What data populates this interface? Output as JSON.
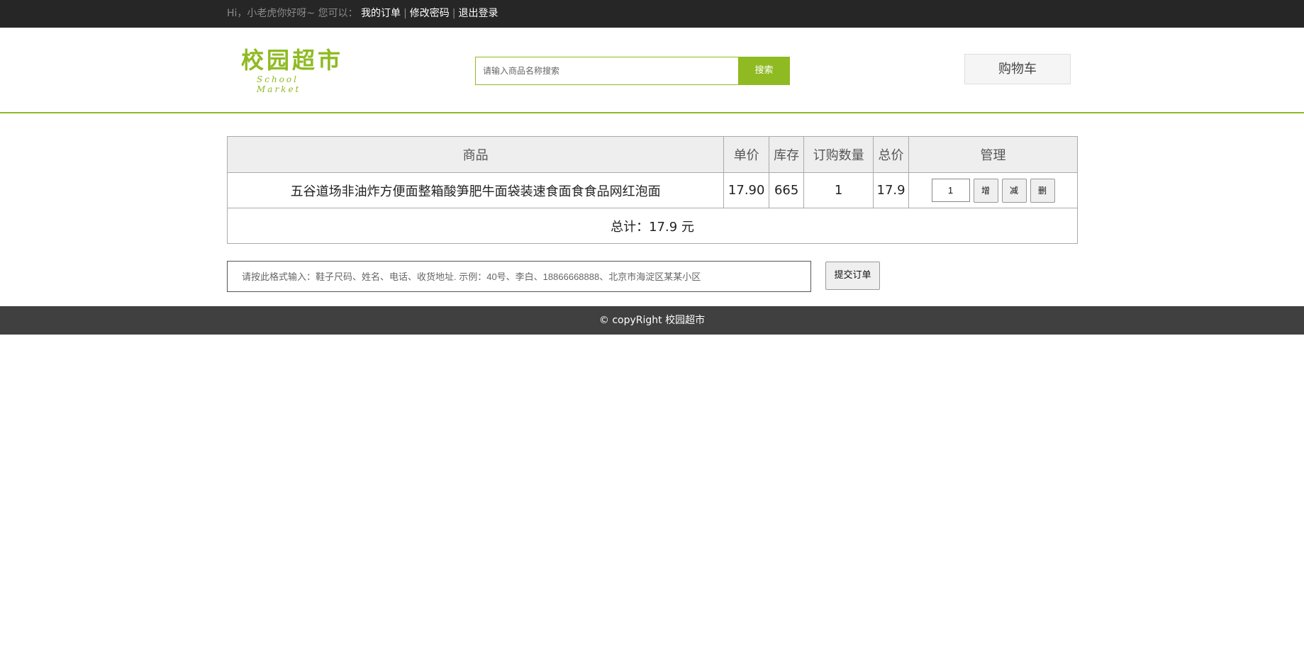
{
  "topbar": {
    "greeting": "Hi，小老虎你好呀~ 您可以：",
    "links": [
      "我的订单",
      "修改密码",
      "退出登录"
    ]
  },
  "header": {
    "logo_cn": "校园超市",
    "logo_en": "School Market",
    "search_placeholder": "请输入商品名称搜索",
    "search_button": "搜索",
    "cart_button": "购物车"
  },
  "cart_table": {
    "columns": [
      "商品",
      "单价",
      "库存",
      "订购数量",
      "总价",
      "管理"
    ],
    "rows": [
      {
        "product": "五谷道场非油炸方便面整箱酸笋肥牛面袋装速食面食食品网红泡面",
        "unit_price": "17.90",
        "stock": "665",
        "quantity": "1",
        "total": "17.9",
        "qty_input": "1",
        "btn_add": "增",
        "btn_minus": "减",
        "btn_delete": "删"
      }
    ],
    "summary": "总计：17.9 元"
  },
  "order": {
    "placeholder": "请按此格式输入：鞋子尺码、姓名、电话、收货地址. 示例：40号、李白、18866668888、北京市海淀区某某小区",
    "submit_button": "提交订单"
  },
  "footer": {
    "copyright": "© copyRight 校园超市"
  },
  "colors": {
    "accent": "#8fba22",
    "topbar_bg": "#262626",
    "footer_bg": "#404040"
  }
}
